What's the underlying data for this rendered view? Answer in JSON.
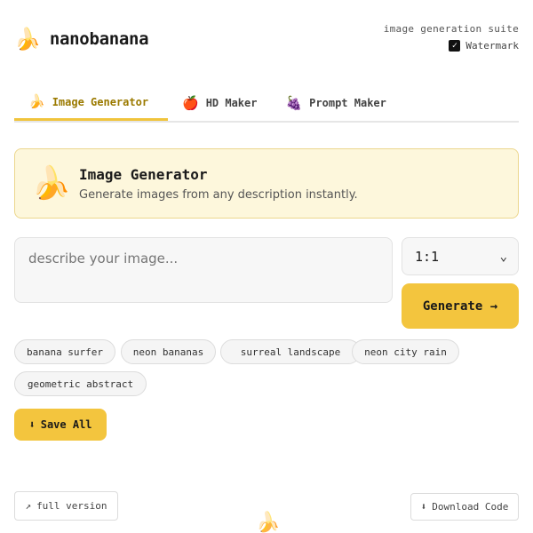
{
  "header": {
    "logo_icon": "🍌",
    "brand": "nanobanana",
    "suite_label": "image generation suite",
    "watermark_label": "Watermark",
    "watermark_checked": true
  },
  "tabs": [
    {
      "icon": "🍌",
      "label": "Image Generator",
      "active": true
    },
    {
      "icon": "🍎",
      "label": "HD Maker",
      "active": false
    },
    {
      "icon": "🍇",
      "label": "Prompt Maker",
      "active": false
    }
  ],
  "banner": {
    "icon": "🍌",
    "title": "Image Generator",
    "subtitle": "Generate images from any description instantly."
  },
  "prompt": {
    "placeholder": "describe your image...",
    "value": ""
  },
  "ratio": {
    "selected": "1:1",
    "chevron": "⌄"
  },
  "generate_label": "Generate →",
  "chips": [
    "banana surfer",
    "neon bananas",
    "surreal landscape",
    "neon city rain",
    "geometric abstract"
  ],
  "save_all": {
    "icon": "⬇",
    "label": "Save All"
  },
  "footer": {
    "full_icon": "↗",
    "full_label": "full version",
    "download_icon": "⬇",
    "download_label": "Download Code",
    "bottom_icon": "🍌"
  },
  "colors": {
    "accent": "#f3c53e",
    "accent_text": "#9b7a00",
    "banner_bg": "#fdf7dc",
    "banner_border": "#ecd78e"
  }
}
